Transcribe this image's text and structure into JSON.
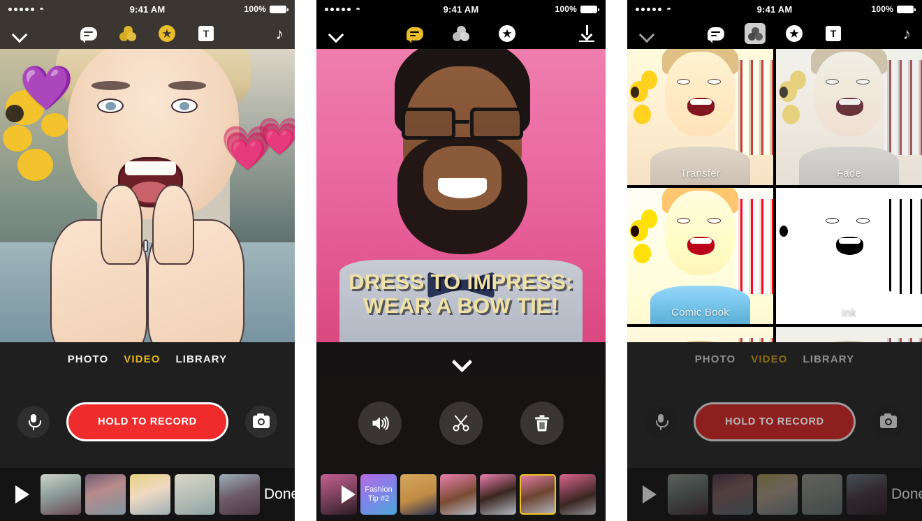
{
  "panels": [
    {
      "id": "panel-capture",
      "statusbar": {
        "time": "9:41 AM",
        "battery": "100%",
        "signal_dots": 5
      },
      "toolbar": {
        "back_label": "chevron-down",
        "icons": [
          "captions-icon",
          "filters-icon",
          "stickers-icon",
          "text-icon",
          "music-icon"
        ]
      },
      "caption_overlay": "",
      "stickers": [
        "💜",
        "💗",
        "💗"
      ],
      "modes": {
        "items": [
          "PHOTO",
          "VIDEO",
          "LIBRARY"
        ],
        "active": "VIDEO"
      },
      "record": {
        "label": "HOLD TO RECORD"
      },
      "controls": {
        "mic": "microphone-icon",
        "flip": "flip-camera-icon"
      },
      "filmstrip": {
        "play": "play-icon",
        "done_label": "Done",
        "clips": [
          {
            "label": "",
            "selected": false
          },
          {
            "label": "",
            "selected": false
          },
          {
            "label": "",
            "selected": false
          },
          {
            "label": "",
            "selected": false
          },
          {
            "label": "",
            "selected": false
          }
        ]
      }
    },
    {
      "id": "panel-edit",
      "statusbar": {
        "time": "9:41 AM",
        "battery": "100%",
        "signal_dots": 5
      },
      "toolbar": {
        "back_label": "chevron-down",
        "icons": [
          "captions-icon",
          "filters-icon",
          "stickers-icon"
        ],
        "right_icon": "download-icon",
        "active_icon": "captions-icon"
      },
      "caption_overlay": "DRESS TO IMPRESS:\nWEAR A BOW TIE!",
      "caption_line1": "DRESS TO IMPRESS:",
      "caption_line2": "WEAR A BOW TIE!",
      "collapse": "chevron-down-icon",
      "edit_controls": [
        {
          "name": "volume",
          "icon": "speaker-icon"
        },
        {
          "name": "trim",
          "icon": "scissors-icon"
        },
        {
          "name": "delete",
          "icon": "trash-icon"
        }
      ],
      "filmstrip": {
        "play": "play-icon",
        "clips": [
          {
            "label": "",
            "selected": false
          },
          {
            "label": "Fashion\nTip #2",
            "label_l1": "Fashion",
            "label_l2": "Tip #2",
            "selected": false
          },
          {
            "label": "",
            "selected": false
          },
          {
            "label": "",
            "selected": false
          },
          {
            "label": "",
            "selected": false
          },
          {
            "label": "",
            "selected": true
          },
          {
            "label": "",
            "selected": false
          }
        ]
      }
    },
    {
      "id": "panel-filters",
      "statusbar": {
        "time": "9:41 AM",
        "battery": "100%",
        "signal_dots": 5
      },
      "toolbar": {
        "back_label": "chevron-down",
        "icons": [
          "captions-icon",
          "filters-icon",
          "stickers-icon",
          "text-icon",
          "music-icon"
        ],
        "active_icon": "filters-icon"
      },
      "filters": [
        {
          "name": "Transfer"
        },
        {
          "name": "Fade"
        },
        {
          "name": "Comic Book"
        },
        {
          "name": "Ink"
        }
      ],
      "modes": {
        "items": [
          "PHOTO",
          "VIDEO",
          "LIBRARY"
        ],
        "active": "VIDEO"
      },
      "record": {
        "label": "HOLD TO RECORD"
      },
      "controls": {
        "mic": "microphone-icon",
        "flip": "flip-camera-icon"
      },
      "filmstrip": {
        "play": "play-icon",
        "done_label": "Done",
        "clips": [
          {
            "label": "",
            "selected": false
          },
          {
            "label": "",
            "selected": false
          },
          {
            "label": "",
            "selected": false
          },
          {
            "label": "",
            "selected": false
          },
          {
            "label": "",
            "selected": false
          }
        ]
      }
    }
  ],
  "colors": {
    "accent_gold": "#e3b322",
    "record_red": "#ef2b2b",
    "caption_yellow": "#f0e2a6",
    "selected_thumb": "#f0c419",
    "pink_bg": "#e8629c"
  }
}
